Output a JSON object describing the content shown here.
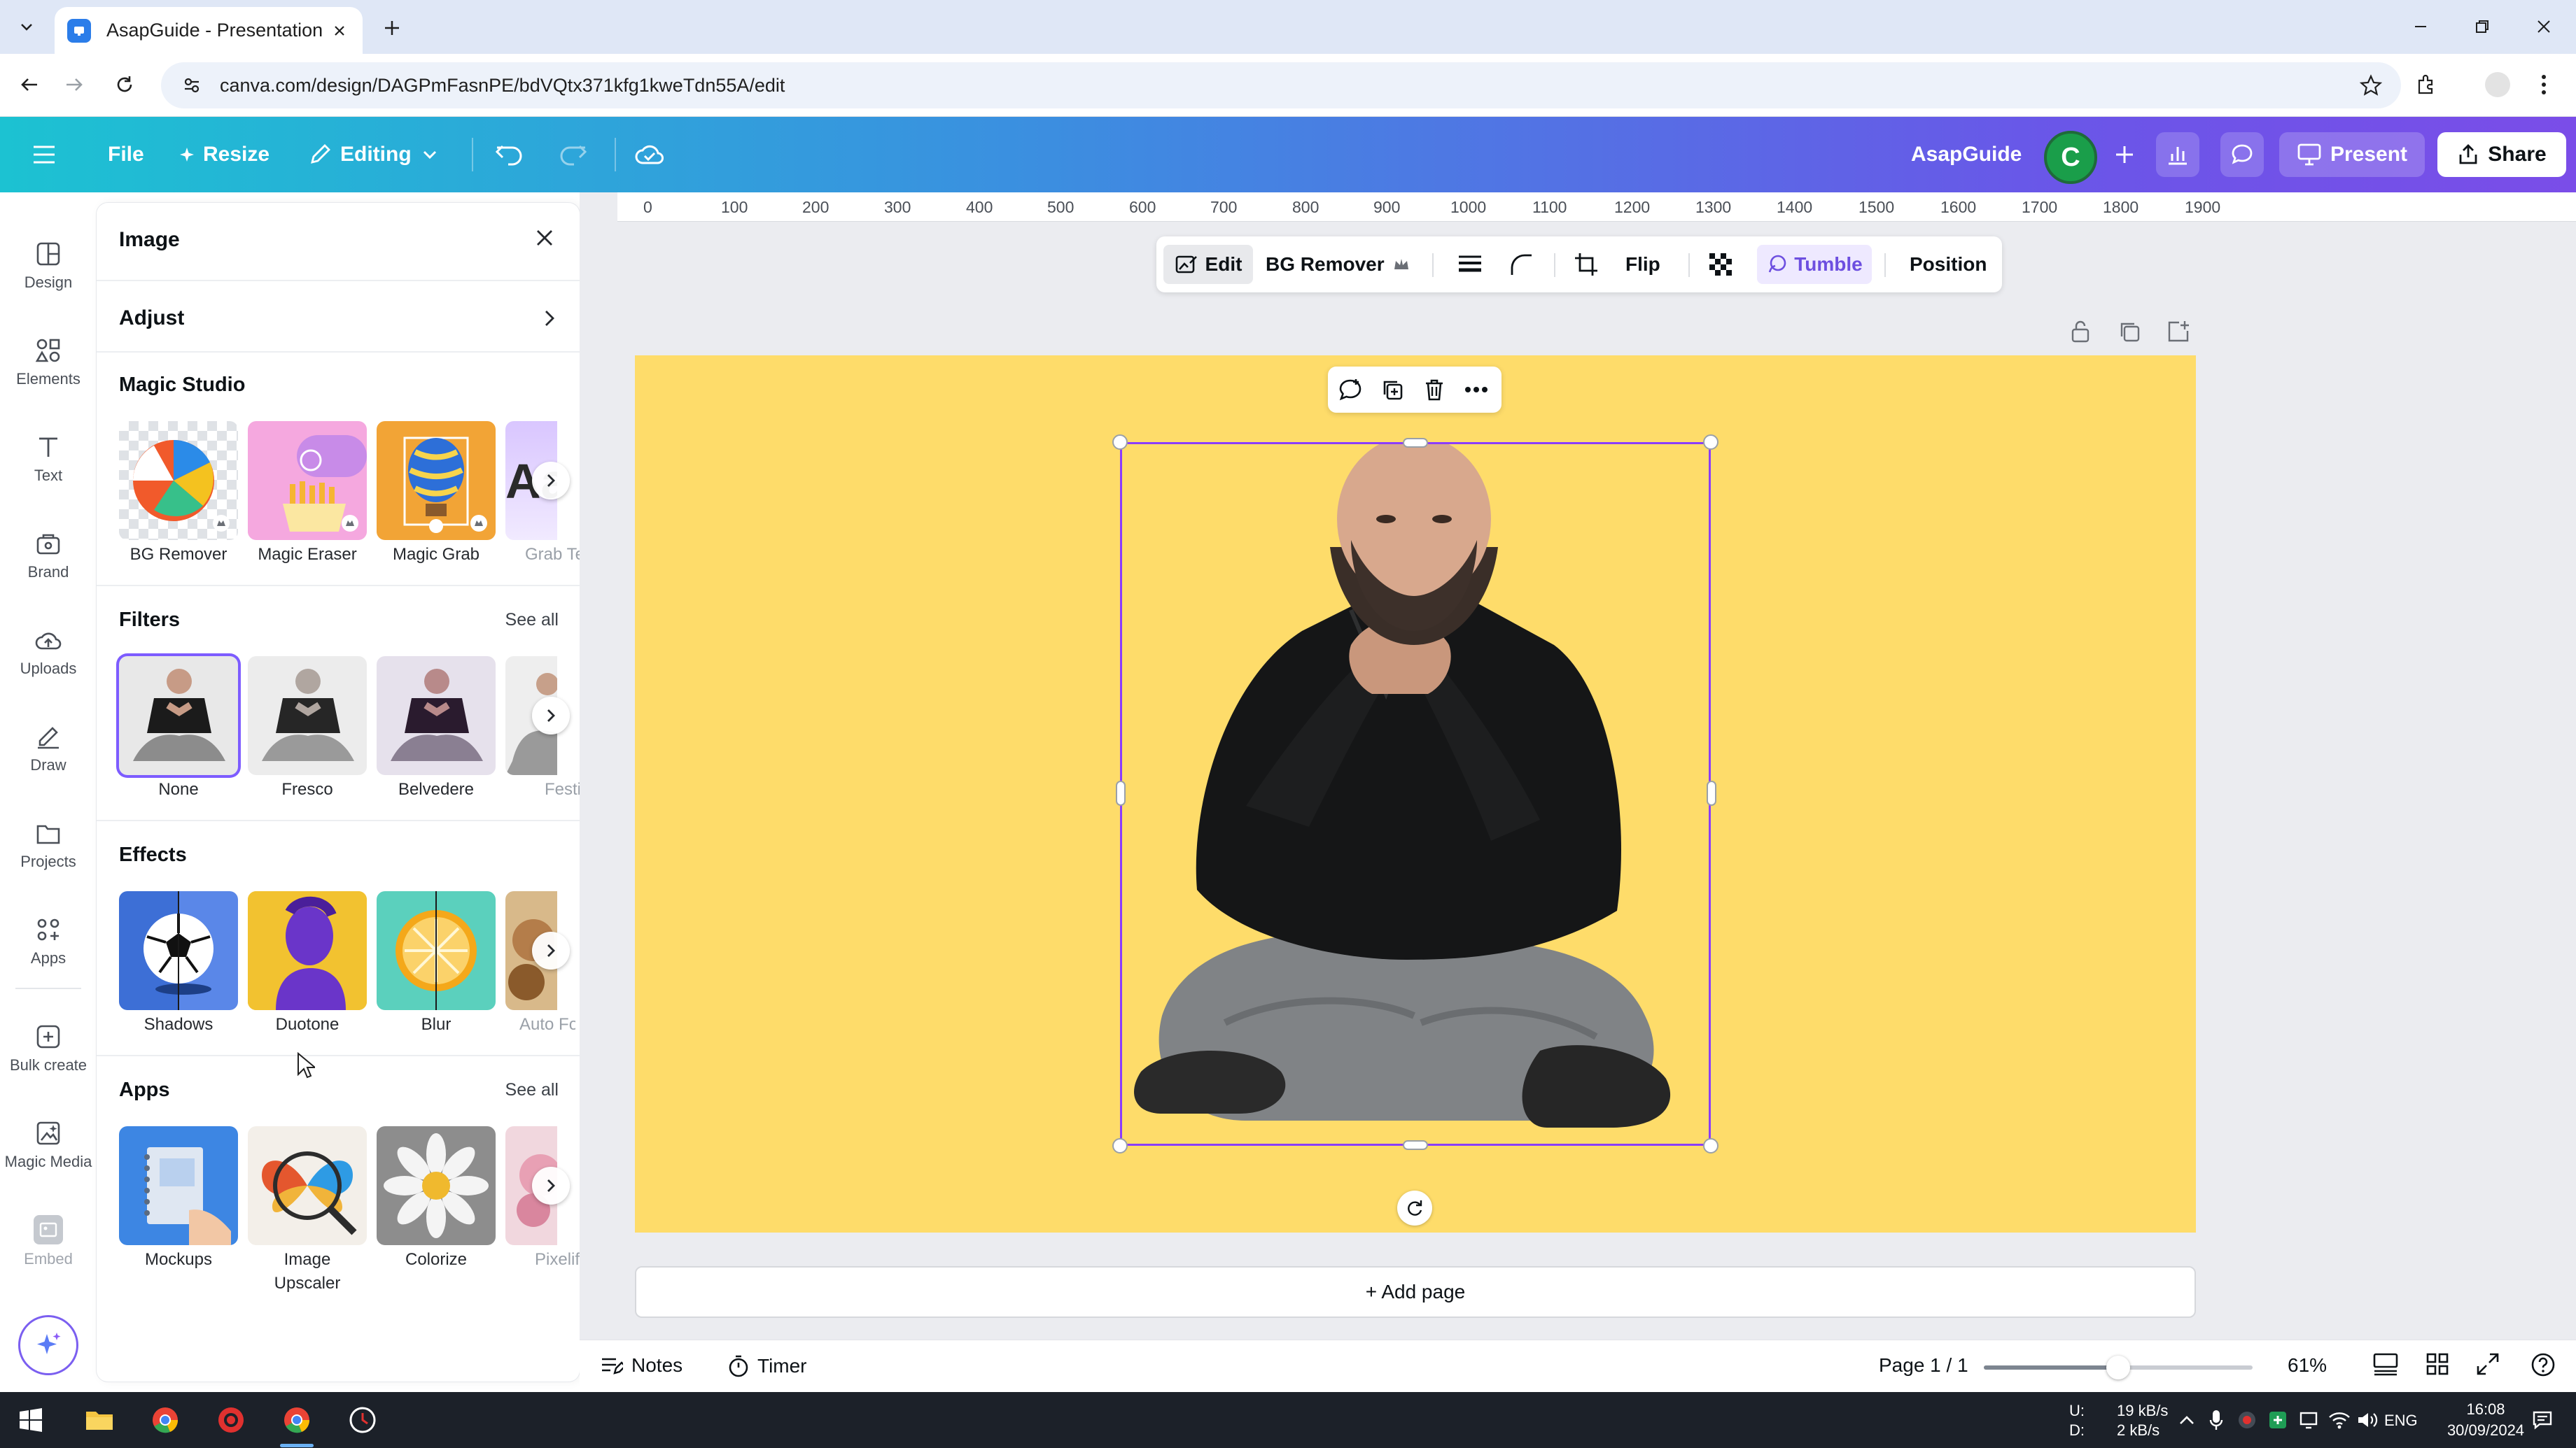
{
  "browser": {
    "tab_title": "AsapGuide - Presentation",
    "url": "canva.com/design/DAGPmFasnPE/bdVQtx371kfg1kweTdn55A/edit"
  },
  "header": {
    "file": "File",
    "resize": "Resize",
    "editing": "Editing",
    "team_name": "AsapGuide",
    "avatar_letter": "C",
    "present": "Present",
    "share": "Share"
  },
  "rail": {
    "design": "Design",
    "elements": "Elements",
    "text": "Text",
    "brand": "Brand",
    "uploads": "Uploads",
    "draw": "Draw",
    "projects": "Projects",
    "apps": "Apps",
    "bulk_create": "Bulk create",
    "magic_media": "Magic Media",
    "embed": "Embed"
  },
  "panel": {
    "title": "Image",
    "adjust": "Adjust",
    "magic_studio": {
      "title": "Magic Studio",
      "items": [
        "BG Remover",
        "Magic Eraser",
        "Magic Grab",
        "Grab Text"
      ]
    },
    "filters": {
      "title": "Filters",
      "see_all": "See all",
      "items": [
        "None",
        "Fresco",
        "Belvedere",
        "Festive"
      ]
    },
    "effects": {
      "title": "Effects",
      "items": [
        "Shadows",
        "Duotone",
        "Blur",
        "Auto Focus"
      ]
    },
    "apps": {
      "title": "Apps",
      "see_all": "See all",
      "items": [
        "Mockups",
        "Image Upscaler",
        "Colorize",
        "Pixelify"
      ]
    }
  },
  "context_toolbar": {
    "edit": "Edit",
    "bg_remover": "BG Remover",
    "flip": "Flip",
    "tumble": "Tumble",
    "position": "Position"
  },
  "ruler": [
    "0",
    "100",
    "200",
    "300",
    "400",
    "500",
    "600",
    "700",
    "800",
    "900",
    "1000",
    "1100",
    "1200",
    "1300",
    "1400",
    "1500",
    "1600",
    "1700",
    "1800",
    "1900"
  ],
  "canvas": {
    "add_page": "+ Add page",
    "page_color": "#fedc6a"
  },
  "footer": {
    "notes": "Notes",
    "timer": "Timer",
    "page_indicator": "Page 1 / 1",
    "zoom": "61%",
    "zoom_level": 0.5
  },
  "taskbar": {
    "net_up_label": "U:",
    "net_up": "19 kB/s",
    "net_down_label": "D:",
    "net_down": "2 kB/s",
    "lang": "ENG",
    "time": "16:08",
    "date": "30/09/2024"
  },
  "colors": {
    "accent": "#8b3dff",
    "header_start": "#1cc2d2",
    "header_end": "#7a4de8"
  }
}
